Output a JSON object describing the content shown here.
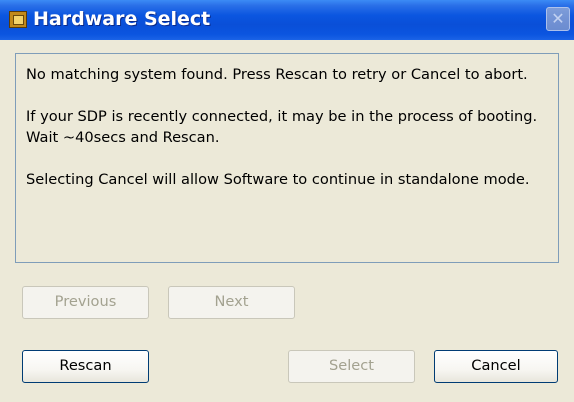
{
  "window": {
    "title": "Hardware Select",
    "close_glyph": "✕",
    "icon_name": "labview-app-icon"
  },
  "message": {
    "paragraphs": [
      "No matching system found. Press Rescan to retry or Cancel to abort.",
      "If your SDP is recently connected, it may be in the process of booting. Wait ~40secs and Rescan.",
      "Selecting Cancel will allow Software to continue in standalone mode."
    ]
  },
  "buttons": {
    "previous": {
      "label": "Previous",
      "enabled": false
    },
    "next": {
      "label": "Next",
      "enabled": false
    },
    "rescan": {
      "label": "Rescan",
      "enabled": true
    },
    "select": {
      "label": "Select",
      "enabled": false
    },
    "cancel": {
      "label": "Cancel",
      "enabled": true
    }
  },
  "colors": {
    "titlebar": "#0b56e0",
    "dialog_background": "#ece9d8",
    "disabled_text": "#a3a290",
    "button_border": "#003c74"
  }
}
